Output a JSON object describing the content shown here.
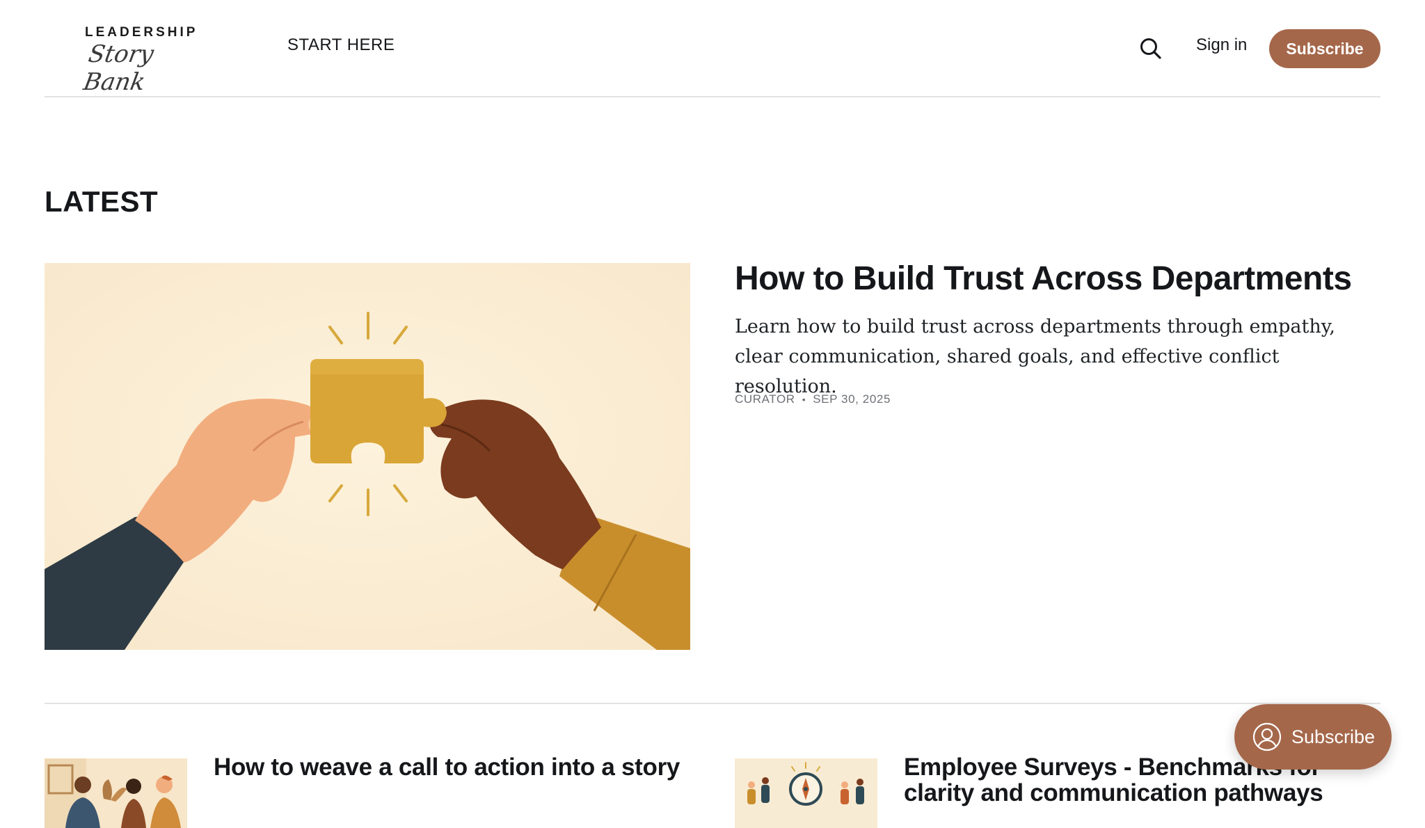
{
  "header": {
    "logo_top": "LEADERSHIP",
    "logo_script": "Story Bank",
    "nav_start": "START HERE",
    "search_icon": "search-icon",
    "signin_label": "Sign in",
    "subscribe_label": "Subscribe"
  },
  "latest": {
    "heading": "LATEST"
  },
  "feature": {
    "title": "How to Build Trust Across Departments",
    "excerpt": "Learn how to build trust across departments through empathy, clear communication, shared goals, and effective conflict resolution.",
    "author": "CURATOR",
    "separator": "•",
    "date": "SEP 30, 2025"
  },
  "cards": [
    {
      "title": "How to weave a call to action into a story"
    },
    {
      "title": "Employee Surveys - Benchmarks for clarity and communication pathways"
    }
  ],
  "floating_subscribe": {
    "icon": "user-circle-icon",
    "label": "Subscribe"
  },
  "colors": {
    "accent": "#a5674a",
    "text": "#15171a",
    "meta": "#6d7075",
    "divider": "#e3e3e3",
    "image_bg": "#fbecd4"
  }
}
